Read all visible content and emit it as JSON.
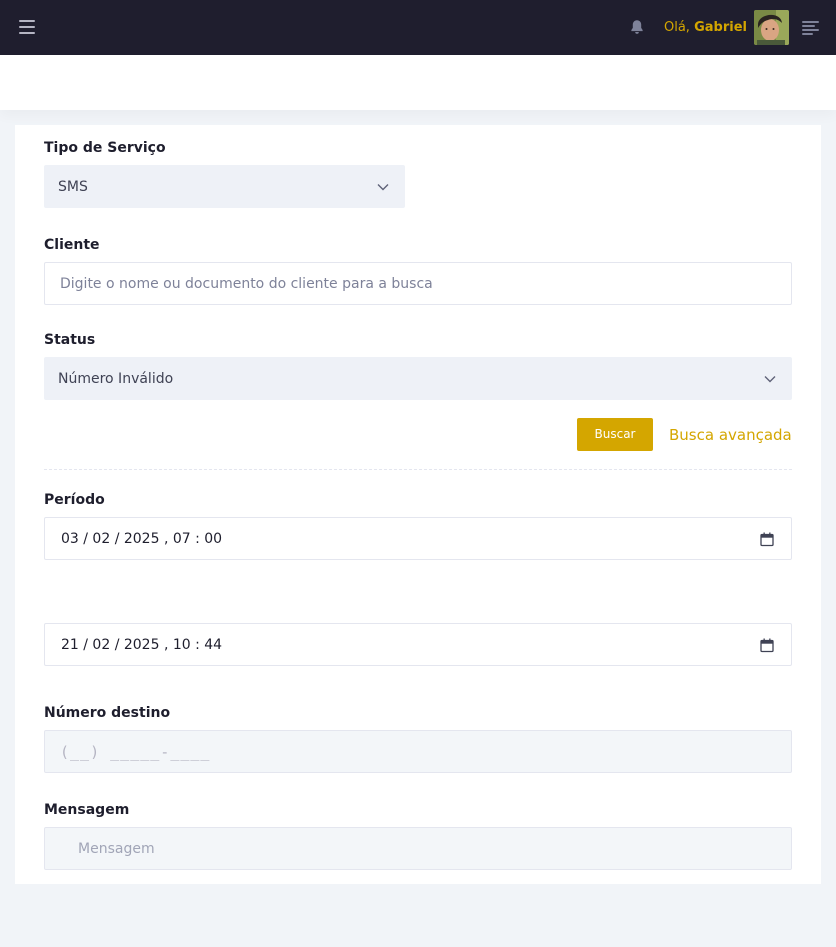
{
  "header": {
    "greeting_prefix": "Olá,",
    "user_name": "Gabriel",
    "menu_icon": "hamburger-icon",
    "notification_icon": "bell-icon",
    "right_menu_icon": "align-right-icon",
    "accent_color": "#d4a600"
  },
  "form": {
    "service_type": {
      "label": "Tipo de Serviço",
      "value": "SMS"
    },
    "client": {
      "label": "Cliente",
      "placeholder": "Digite o nome ou documento do cliente para a busca"
    },
    "status": {
      "label": "Status",
      "value": "Número Inválido"
    },
    "search_button": "Buscar",
    "advanced_link": "Busca avançada",
    "period": {
      "label": "Período",
      "start": "03 / 02 / 2025 ,  07 : 00",
      "end": "21 / 02 / 2025 ,  10 : 44"
    },
    "destination": {
      "label": "Número destino",
      "placeholder": "(__) _____-____"
    },
    "message": {
      "label": "Mensagem",
      "placeholder": "Mensagem"
    }
  }
}
